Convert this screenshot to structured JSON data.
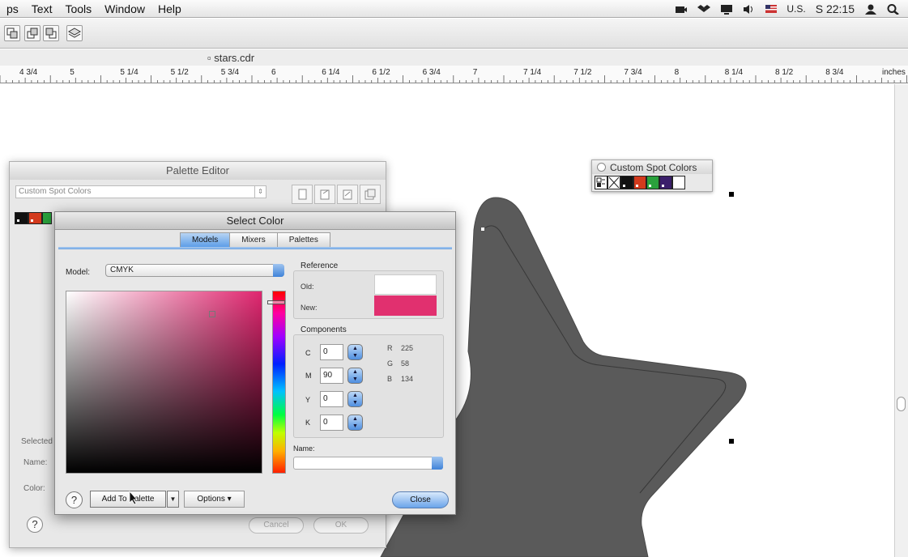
{
  "menubar": {
    "items": [
      "ps",
      "Text",
      "Tools",
      "Window",
      "Help"
    ],
    "input_source": "U.S.",
    "clock": "S 22:15"
  },
  "document": {
    "title": "stars.cdr"
  },
  "ruler": {
    "labels": [
      "4 3/4",
      "5",
      "5 1/4",
      "5 1/2",
      "5 3/4",
      "6",
      "6 1/4",
      "6 1/2",
      "6 3/4",
      "7",
      "7 1/4",
      "7 1/2",
      "7 3/4",
      "8",
      "8 1/4",
      "8 1/2",
      "8 3/4"
    ],
    "unit": "inches"
  },
  "spot_palette": {
    "title": "Custom Spot Colors",
    "swatches": [
      "#111111",
      "#d33a1d",
      "#2aa13c",
      "#3b1f6b",
      "#ffffff"
    ]
  },
  "palette_editor": {
    "title": "Palette Editor",
    "palette_name": "Custom Spot Colors",
    "selected_label": "Selected",
    "name_label": "Name:",
    "color_label": "Color:",
    "cancel_label": "Cancel",
    "ok_label": "OK",
    "help_label": "?"
  },
  "select_color": {
    "title": "Select Color",
    "tabs": [
      "Models",
      "Mixers",
      "Palettes"
    ],
    "active_tab": "Models",
    "model_label": "Model:",
    "model_value": "CMYK",
    "reference_title": "Reference",
    "old_label": "Old:",
    "new_label": "New:",
    "old_color": "#ffffff",
    "new_color": "#e1306f",
    "components_title": "Components",
    "components": [
      {
        "label": "C",
        "value": "0"
      },
      {
        "label": "M",
        "value": "90"
      },
      {
        "label": "Y",
        "value": "0"
      },
      {
        "label": "K",
        "value": "0"
      }
    ],
    "rgb": [
      {
        "label": "R",
        "value": "225"
      },
      {
        "label": "G",
        "value": "58"
      },
      {
        "label": "B",
        "value": "134"
      }
    ],
    "name_label": "Name:",
    "name_value": "",
    "help_label": "?",
    "add_to_palette_label": "Add To Palette",
    "options_label": "Options",
    "close_label": "Close"
  },
  "colors": {
    "star_fill": "#5a5a5a",
    "accent_blue": "#5d9ee8"
  }
}
